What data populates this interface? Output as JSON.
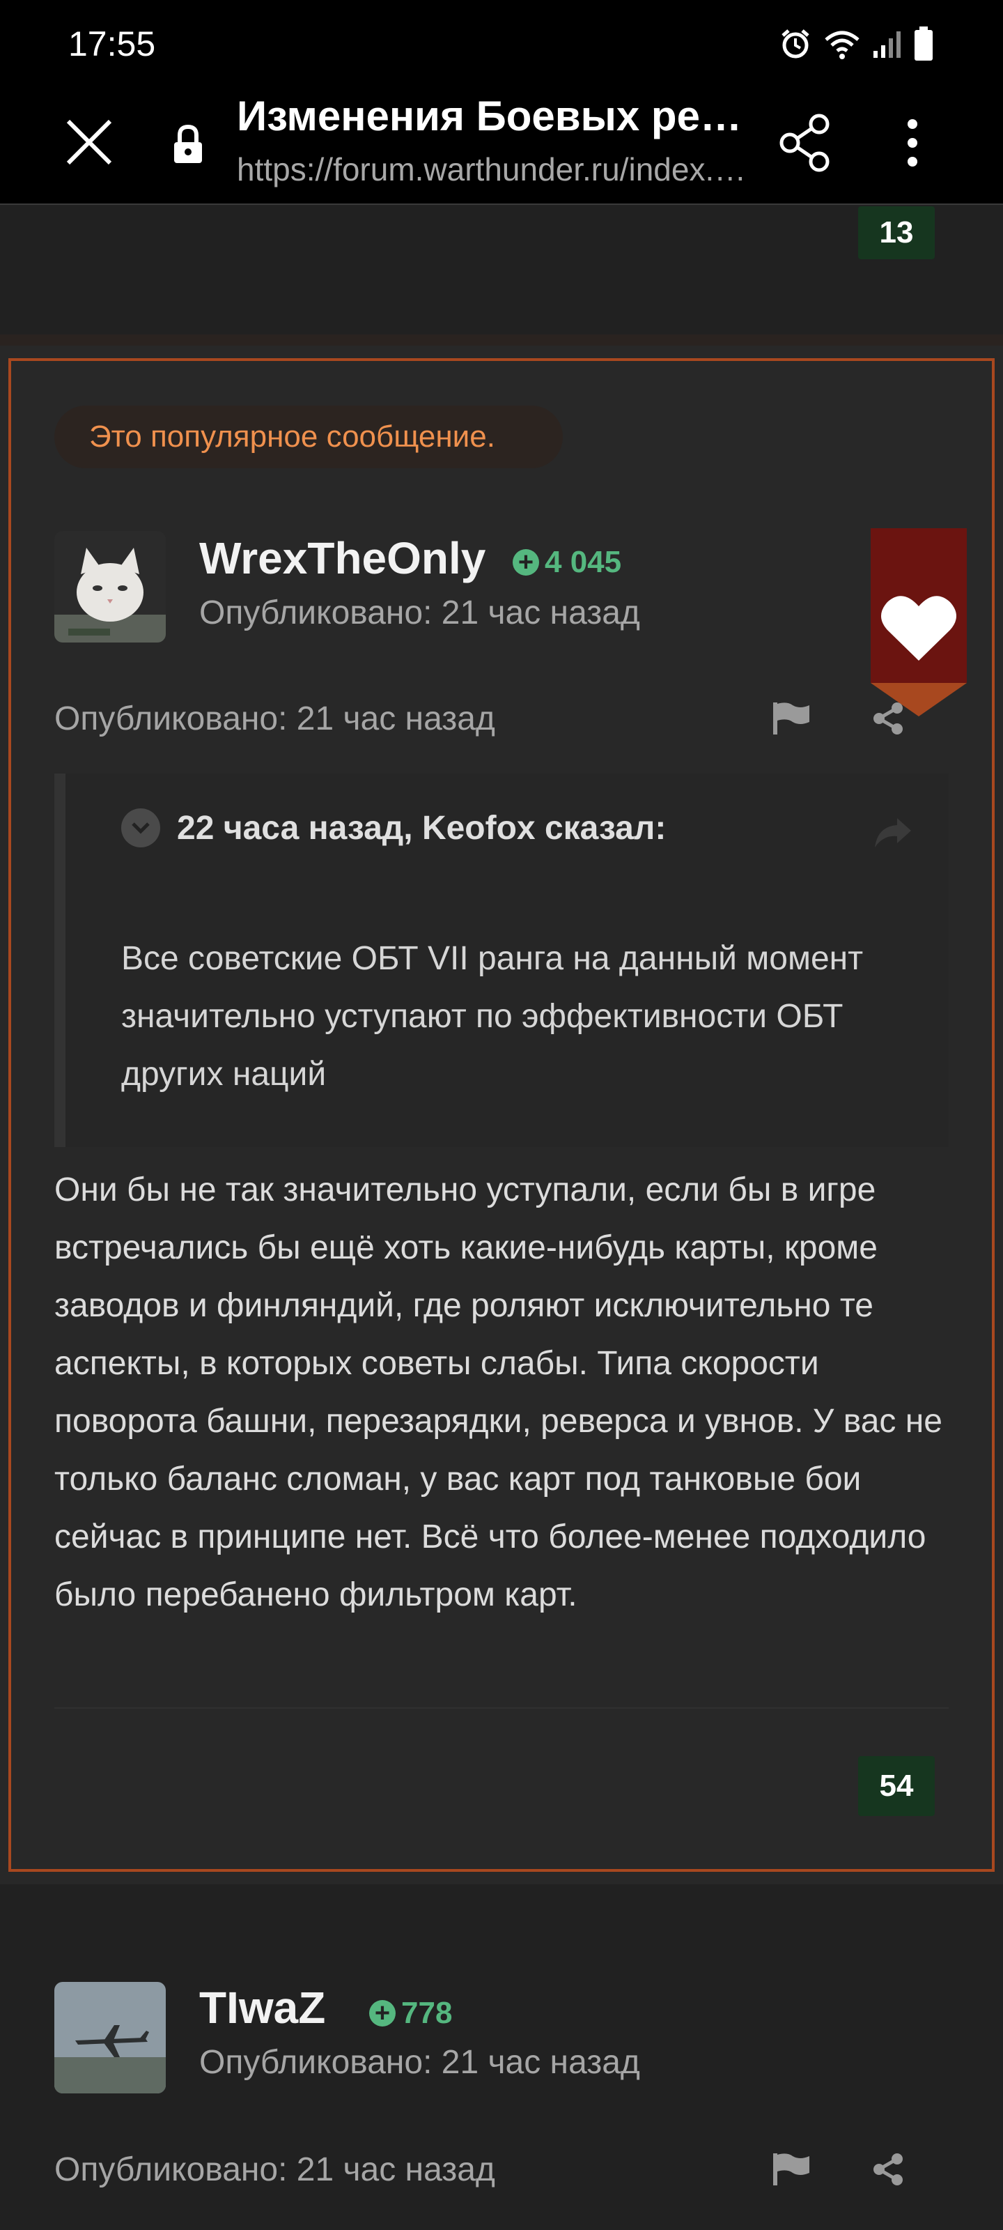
{
  "status_bar": {
    "time": "17:55"
  },
  "browser": {
    "title": "Изменения Боевых рейт…",
    "url": "https://forum.warthunder.ru/index.…"
  },
  "prev_post": {
    "reactions": "13"
  },
  "popular_post": {
    "label": "Это популярное сообщение.",
    "author": "WrexTheOnly",
    "reputation": "4 045",
    "published_header": "Опубликовано: 21 час назад",
    "published": "Опубликовано: 21 час назад",
    "quote": {
      "header": "22 часа назад, Keofox сказал:",
      "text": "Все советские ОБТ VII ранга на данный момент значительно уступают по эффективности ОБТ других наций"
    },
    "body": "Они бы не так значительно уступали, если бы в игре встречались бы ещё хоть какие-нибудь карты, кроме заводов и финляндий, где роляют исключительно те аспекты, в которых советы слабы. Типа скорости поворота башни, перезарядки, реверса и увнов. У вас не только баланс сломан, у вас карт под танковые бои сейчас в принципе нет. Всё что более-менее подходило было перебанено фильтром карт.",
    "reactions": "54"
  },
  "next_post": {
    "author": "TIwaZ",
    "reputation": "778",
    "published_header": "Опубликовано: 21 час назад",
    "published": "Опубликовано: 21 час назад"
  },
  "colors": {
    "accent_orange": "#a8481f",
    "reputation_green": "#55b77f",
    "heart_red": "#6b1410"
  }
}
